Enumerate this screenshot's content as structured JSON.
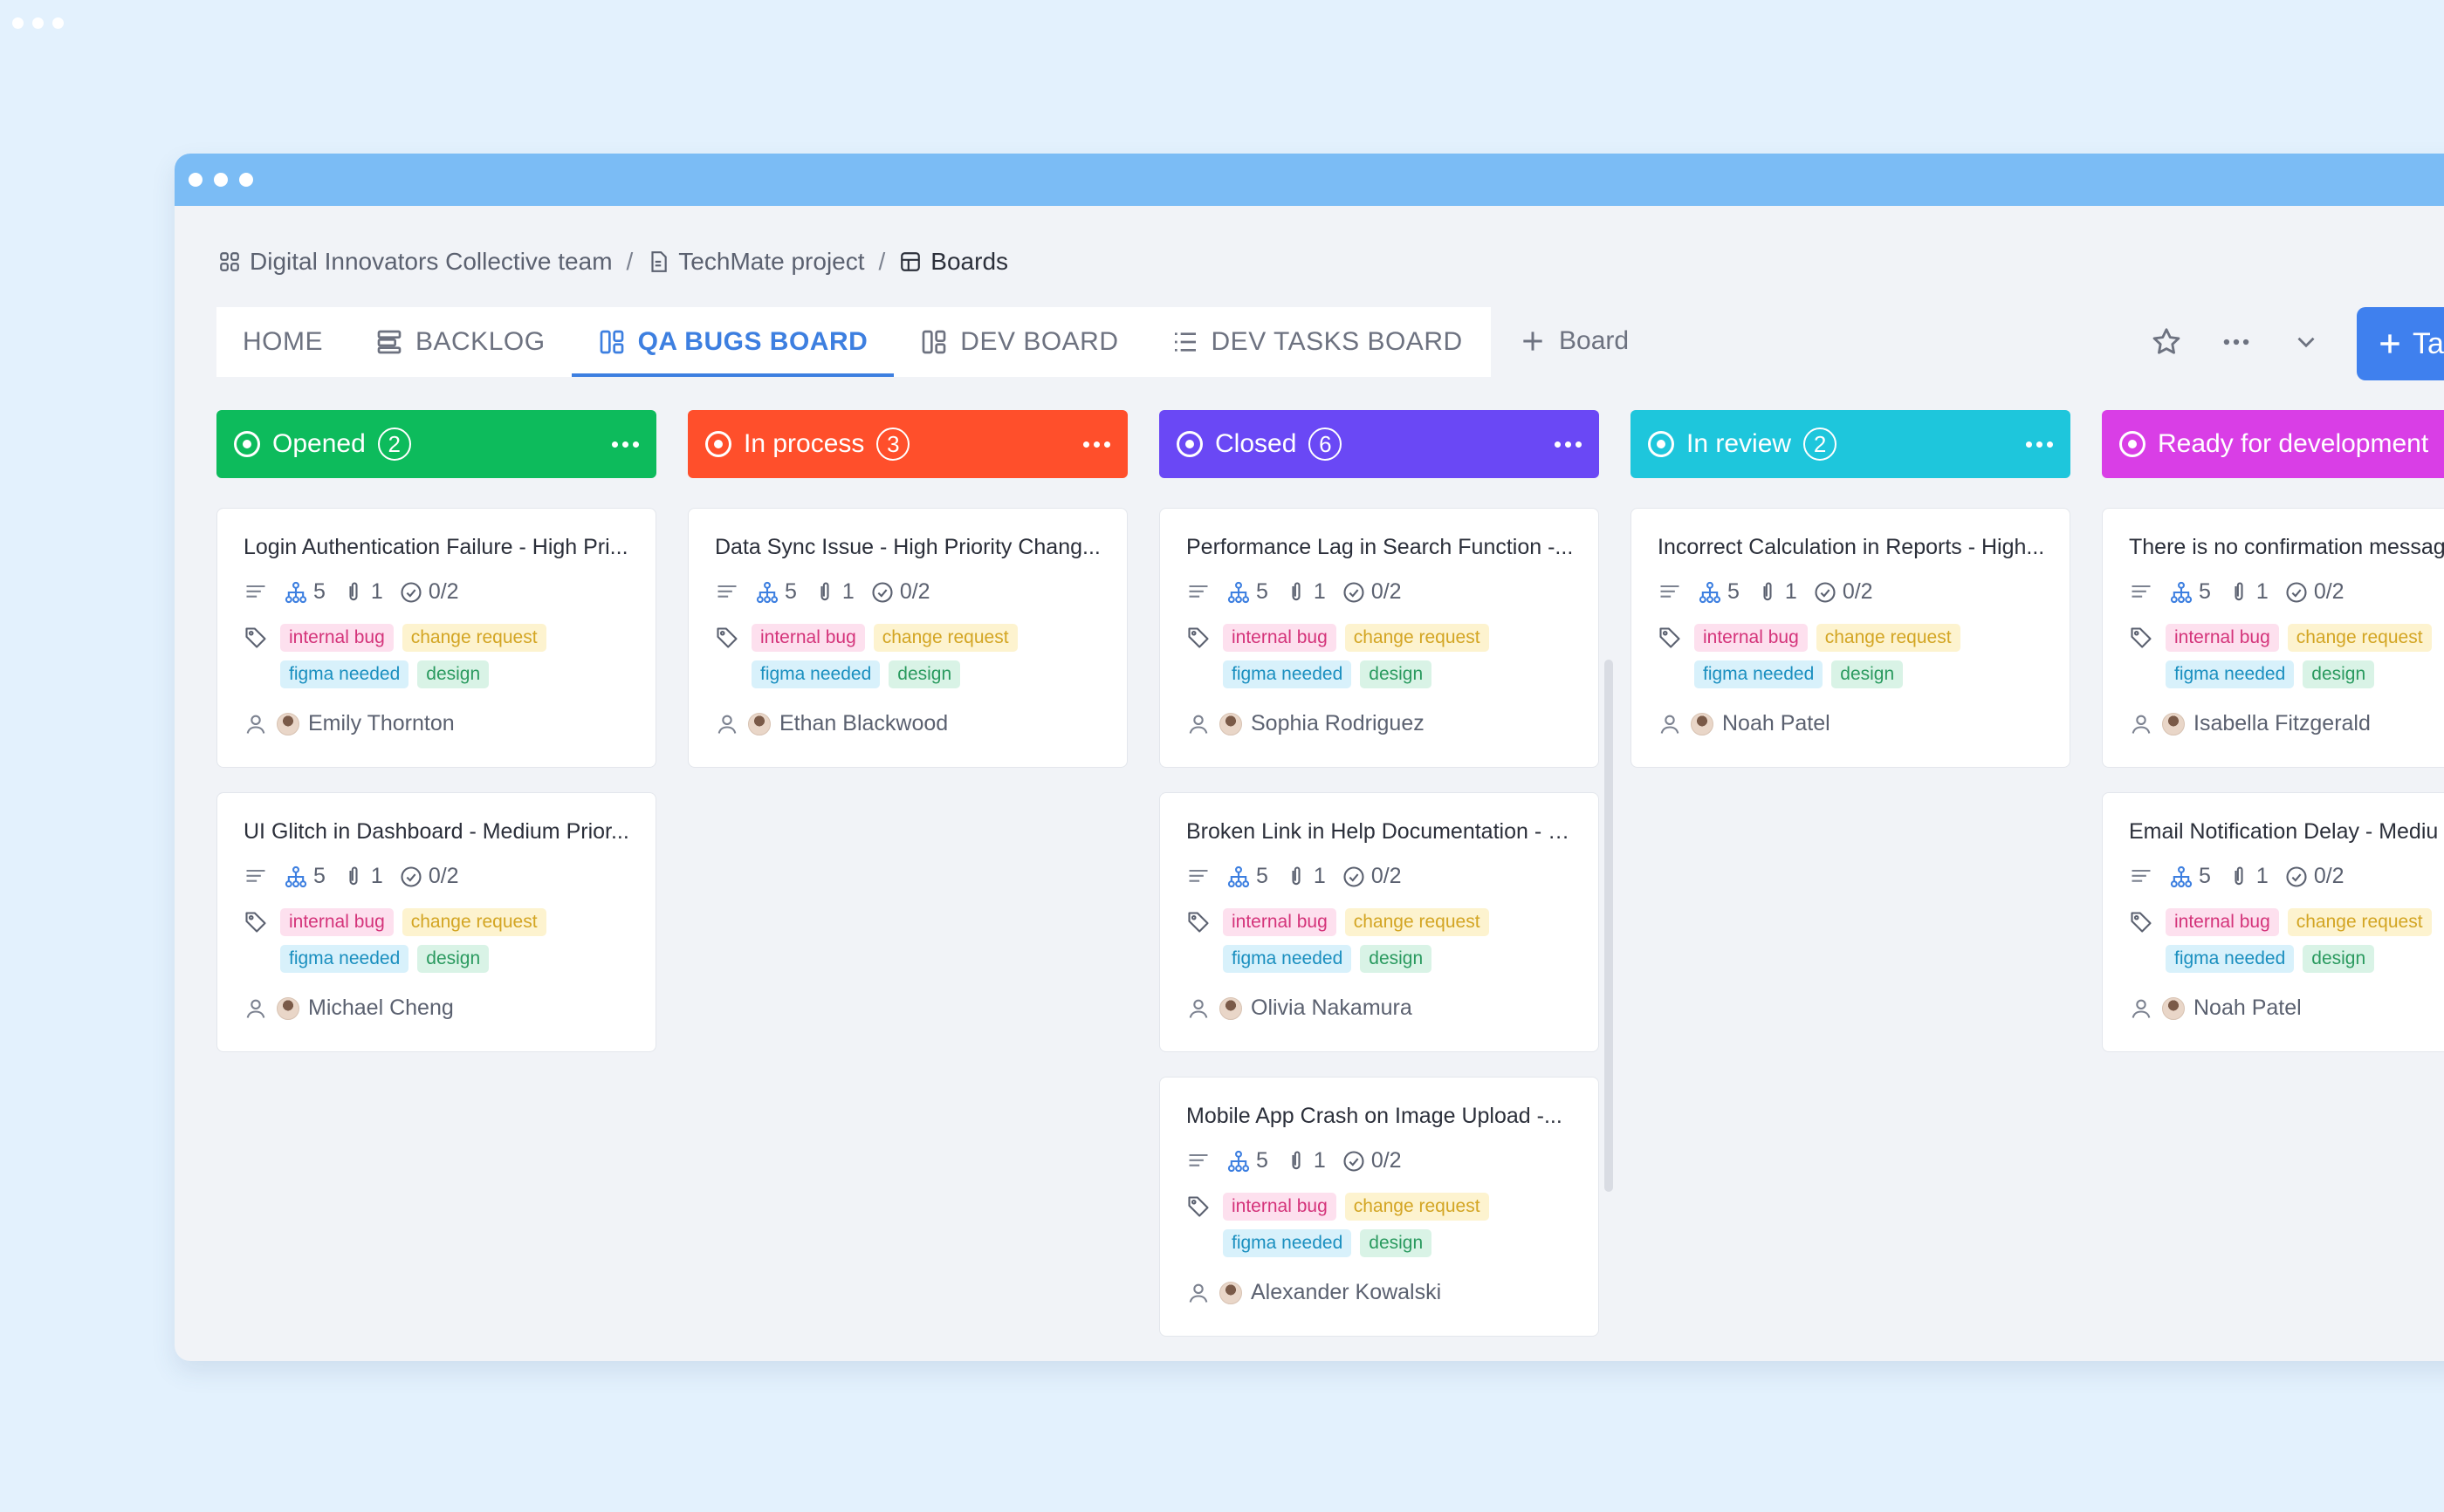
{
  "breadcrumb": [
    {
      "label": "Digital Innovators Collective team"
    },
    {
      "label": "TechMate project"
    },
    {
      "label": "Boards"
    }
  ],
  "tabs": [
    {
      "label": "HOME"
    },
    {
      "label": "BACKLOG"
    },
    {
      "label": "QA BUGS BOARD"
    },
    {
      "label": "DEV BOARD"
    },
    {
      "label": "DEV TASKS BOARD"
    }
  ],
  "active_tab": "QA BUGS BOARD",
  "add_board_label": "Board",
  "new_task_label": "Tas",
  "columns": [
    {
      "title": "Opened",
      "count": "2",
      "color": "#0dbb5c"
    },
    {
      "title": "In process",
      "count": "3",
      "color": "#ff4f2b"
    },
    {
      "title": "Closed",
      "count": "6",
      "color": "#6a48f5"
    },
    {
      "title": "In review",
      "count": "2",
      "color": "#1ec6dc"
    },
    {
      "title": "Ready for development",
      "count": "",
      "color": "#d93ee6"
    }
  ],
  "tag_labels": [
    "internal bug",
    "change request",
    "figma needed",
    "design"
  ],
  "cards": [
    {
      "title": "Login Authentication Failure - High Pri...",
      "subtasks": "5",
      "attachments": "1",
      "checklist": "0/2",
      "assignee": "Emily Thornton"
    },
    {
      "title": "UI Glitch in Dashboard - Medium Prior...",
      "subtasks": "5",
      "attachments": "1",
      "checklist": "0/2",
      "assignee": "Michael Cheng"
    },
    {
      "title": "Data Sync Issue - High Priority Chang...",
      "subtasks": "5",
      "attachments": "1",
      "checklist": "0/2",
      "assignee": "Ethan Blackwood"
    },
    {
      "title": "Performance Lag in Search Function -...",
      "subtasks": "5",
      "attachments": "1",
      "checklist": "0/2",
      "assignee": "Sophia Rodriguez"
    },
    {
      "title": "Broken Link in Help Documentation - L...",
      "subtasks": "5",
      "attachments": "1",
      "checklist": "0/2",
      "assignee": "Olivia Nakamura"
    },
    {
      "title": "Mobile App Crash on Image Upload -...",
      "subtasks": "5",
      "attachments": "1",
      "checklist": "0/2",
      "assignee": "Alexander Kowalski"
    },
    {
      "title": "Incorrect Calculation in Reports - High...",
      "subtasks": "5",
      "attachments": "1",
      "checklist": "0/2",
      "assignee": "Noah Patel"
    },
    {
      "title": "There is no confirmation messag",
      "subtasks": "5",
      "attachments": "1",
      "checklist": "0/2",
      "assignee": "Isabella Fitzgerald"
    },
    {
      "title": "Email Notification Delay - Mediu",
      "subtasks": "5",
      "attachments": "1",
      "checklist": "0/2",
      "assignee": "Noah Patel"
    }
  ],
  "icons": {
    "team": "grid-icon",
    "project": "document-icon",
    "boards": "board-icon",
    "star": "star-icon",
    "more": "more-horizontal-icon",
    "chevron": "chevron-down-icon"
  }
}
